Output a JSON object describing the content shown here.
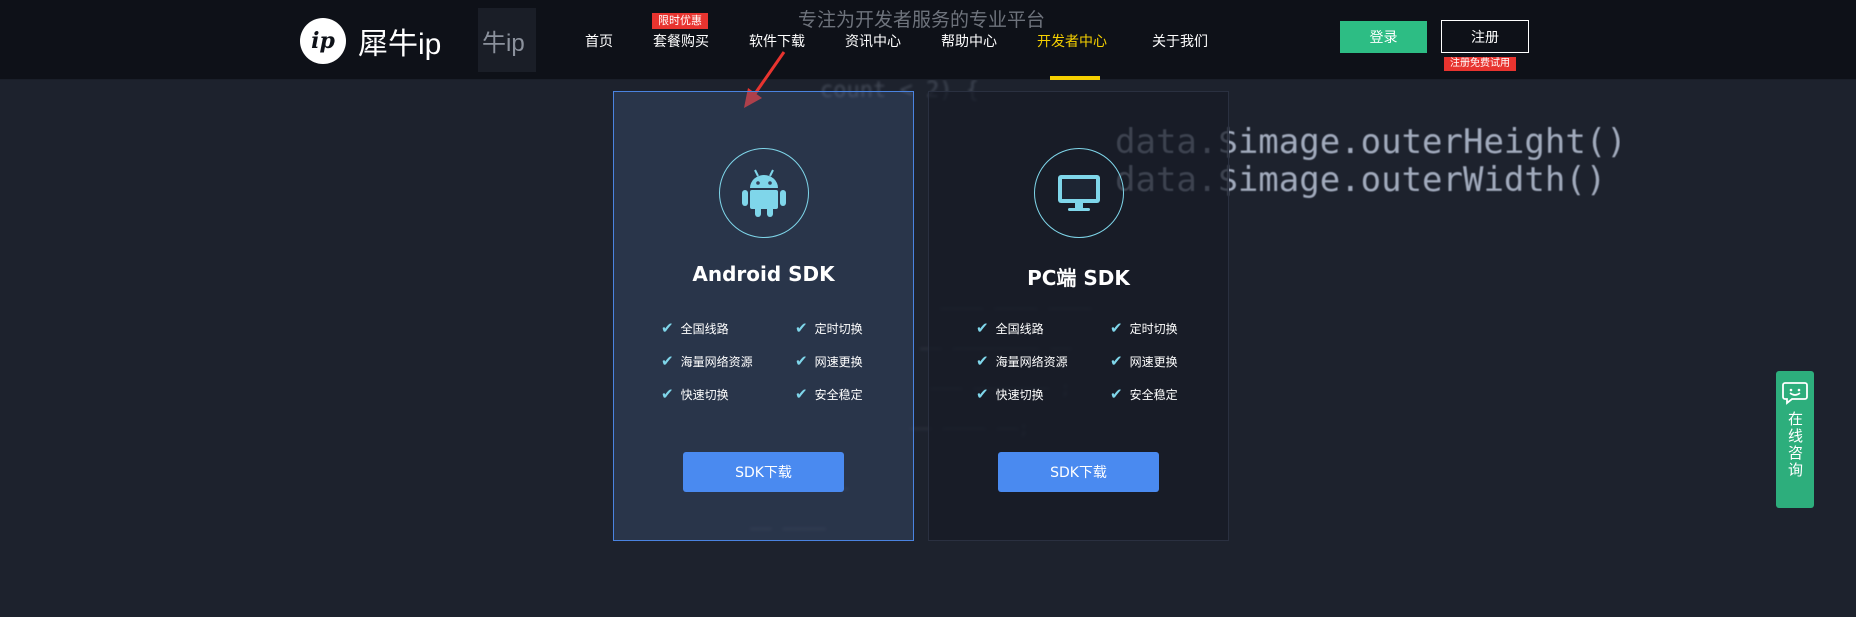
{
  "header": {
    "logo_text": "犀牛ip",
    "logo_mark": "ip",
    "logo_ghost": "牛ip",
    "tagline": "专注为开发者服务的专业平台",
    "nav": [
      {
        "label": "首页"
      },
      {
        "label": "套餐购买",
        "badge": "限时优惠"
      },
      {
        "label": "软件下载"
      },
      {
        "label": "资讯中心"
      },
      {
        "label": "帮助中心"
      },
      {
        "label": "开发者中心",
        "active": true
      },
      {
        "label": "关于我们"
      }
    ],
    "login_label": "登录",
    "register_label": "注册",
    "register_badge": "注册免费试用"
  },
  "cards": [
    {
      "title": "Android SDK",
      "icon": "android-icon",
      "features": [
        "全国线路",
        "定时切换",
        "海量网络资源",
        "网速更换",
        "快速切换",
        "安全稳定"
      ],
      "button": "SDK下载"
    },
    {
      "title": "PC端 SDK",
      "icon": "monitor-icon",
      "features": [
        "全国线路",
        "定时切换",
        "海量网络资源",
        "网速更换",
        "快速切换",
        "安全稳定"
      ],
      "button": "SDK下载"
    }
  ],
  "consult": {
    "label": "在线咨询",
    "icon": "chat-icon"
  },
  "background_code": {
    "line1": "data.$image.outerHeight()",
    "line2": "data.$image.outerWidth()",
    "line3": "count < 2) {"
  },
  "colors": {
    "accent_green": "#2dbd84",
    "accent_blue": "#4a8af0",
    "active_yellow": "#f5d000",
    "badge_red": "#e8342f",
    "icon_cyan": "#7fd6ea"
  }
}
